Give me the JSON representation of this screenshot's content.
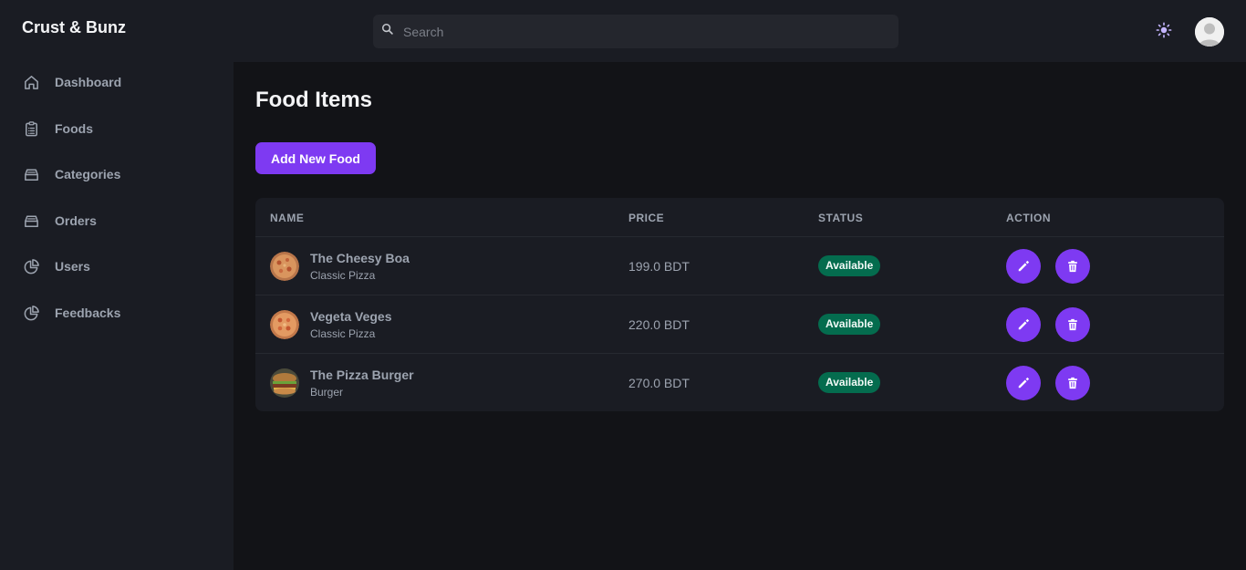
{
  "app": {
    "brand": "Crust & Bunz"
  },
  "header": {
    "search_placeholder": "Search"
  },
  "sidebar": {
    "items": [
      {
        "label": "Dashboard",
        "icon": "home-icon"
      },
      {
        "label": "Foods",
        "icon": "clipboard-list-icon"
      },
      {
        "label": "Categories",
        "icon": "tray-icon"
      },
      {
        "label": "Orders",
        "icon": "tray-icon"
      },
      {
        "label": "Users",
        "icon": "pie-chart-icon"
      },
      {
        "label": "Feedbacks",
        "icon": "pie-chart-icon"
      }
    ]
  },
  "main": {
    "title": "Food Items",
    "add_label": "Add New Food",
    "table": {
      "headers": [
        "NAME",
        "PRICE",
        "STATUS",
        "ACTION"
      ],
      "rows": [
        {
          "name": "The Cheesy Boa",
          "category": "Classic Pizza",
          "price": "199.0 BDT",
          "status": "Available",
          "thumb": "pizza"
        },
        {
          "name": "Vegeta Veges",
          "category": "Classic Pizza",
          "price": "220.0 BDT",
          "status": "Available",
          "thumb": "pizza"
        },
        {
          "name": "The Pizza Burger",
          "category": "Burger",
          "price": "270.0 BDT",
          "status": "Available",
          "thumb": "burger"
        }
      ]
    }
  },
  "colors": {
    "accent": "#7e3af2",
    "status_available": "#046c4e",
    "background": "#121317",
    "panel": "#1a1c23"
  }
}
